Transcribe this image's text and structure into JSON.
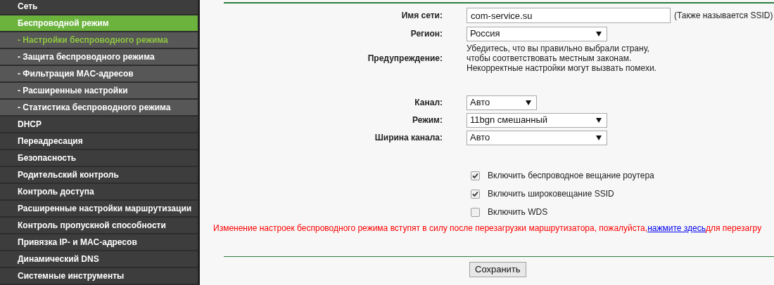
{
  "sidebar": {
    "items": [
      {
        "label": "Сеть",
        "kind": "main",
        "selected": false
      },
      {
        "label": "Беспроводной режим",
        "kind": "main",
        "selected": true
      },
      {
        "label": "- Настройки беспроводного режима",
        "kind": "sub",
        "selected": true
      },
      {
        "label": "- Защита беспроводного режима",
        "kind": "sub",
        "selected": false
      },
      {
        "label": "- Фильтрация MAC-адресов",
        "kind": "sub",
        "selected": false
      },
      {
        "label": "- Расширенные настройки",
        "kind": "sub",
        "selected": false
      },
      {
        "label": "- Статистика беспроводного режима",
        "kind": "sub",
        "selected": false
      },
      {
        "label": "DHCP",
        "kind": "main",
        "selected": false
      },
      {
        "label": "Переадресация",
        "kind": "main",
        "selected": false
      },
      {
        "label": "Безопасность",
        "kind": "main",
        "selected": false
      },
      {
        "label": "Родительский контроль",
        "kind": "main",
        "selected": false
      },
      {
        "label": "Контроль доступа",
        "kind": "main",
        "selected": false
      },
      {
        "label": "Расширенные настройки маршрутизации",
        "kind": "main",
        "selected": false
      },
      {
        "label": "Контроль пропускной способности",
        "kind": "main",
        "selected": false
      },
      {
        "label": "Привязка IP- и MAC-адресов",
        "kind": "main",
        "selected": false
      },
      {
        "label": "Динамический DNS",
        "kind": "main",
        "selected": false
      },
      {
        "label": "Системные инструменты",
        "kind": "main",
        "selected": false
      }
    ]
  },
  "form": {
    "ssid": {
      "label": "Имя сети:",
      "value": "com-service.su",
      "hint": "(Также называется SSID)"
    },
    "region": {
      "label": "Регион:",
      "value": "Россия"
    },
    "warning": {
      "label": "Предупреждение:",
      "lines": [
        "Убедитесь, что вы правильно выбрали страну,",
        "чтобы соответствовать местным законам.",
        "Некорректные настройки могут вызвать помехи."
      ]
    },
    "selects": [
      {
        "label": "Канал:",
        "value": "Авто",
        "kind": "short"
      },
      {
        "label": "Режим:",
        "value": "11bgn смешанный",
        "kind": "long"
      },
      {
        "label": "Ширина канала:",
        "value": "Авто",
        "kind": "long"
      }
    ],
    "checkboxes": [
      {
        "label": "Включить беспроводное вещание роутера",
        "checked": true
      },
      {
        "label": "Включить широковещание SSID",
        "checked": true
      },
      {
        "label": "Включить WDS",
        "checked": false
      }
    ],
    "notice": {
      "text": "Изменение настроек беспроводного режима вступят в силу после перезагрузки маршрутизатора, пожалуйста,",
      "link": "нажмите здесь",
      "tail": "для перезагру"
    },
    "save_button": "Сохранить"
  }
}
